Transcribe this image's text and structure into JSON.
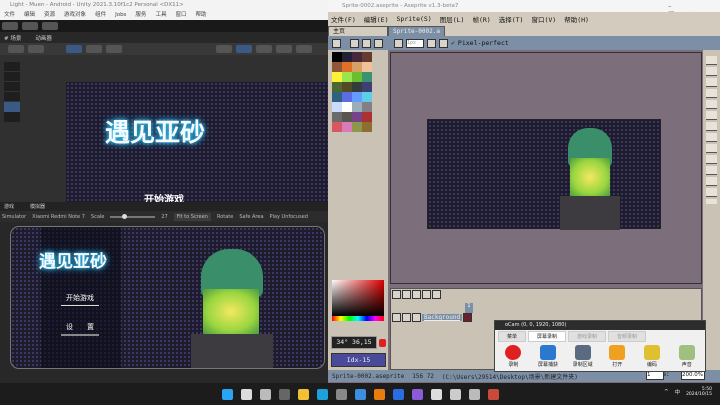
{
  "unity": {
    "title": "Light - Muen - Android - Unity 2021.3.10f1c2 Personal <DX11>",
    "menu": [
      "文件",
      "编辑",
      "资源",
      "游戏对象",
      "组件",
      "Jobs",
      "服务",
      "工具",
      "窗口",
      "帮助"
    ],
    "scene_tabs": [
      "# 场景",
      "动画器"
    ],
    "game_title": "遇见亚砂",
    "scene_start": "开始游戏",
    "game_tabs": [
      "游戏",
      "模拟器"
    ],
    "simulator": {
      "mode": "Simulator",
      "device": "Xiaomi Redmi Note 7",
      "scale_label": "Scale",
      "scale_value": "27",
      "scale_fraction": 0.25,
      "fit": "Fit to Screen",
      "rotate": "Rotate",
      "safe_area": "Safe Area",
      "play": "Play Unfocused"
    },
    "device_title": "遇见亚砂",
    "start_button": "开始游戏",
    "settings_button": "设　　置"
  },
  "aseprite": {
    "title": "Sprite-0002.aseprite - Aseprite v1.3-beta7",
    "menu": [
      "文件(F)",
      "编辑(E)",
      "Sprite(S)",
      "图层(L)",
      "帧(R)",
      "选择(T)",
      "窗口(V)",
      "帮助(H)"
    ],
    "tabs": [
      "主页",
      "Sprite-0002.a"
    ],
    "brush_size": "1px",
    "pixel_perfect": "Pixel-perfect",
    "palette": [
      "#000000",
      "#222034",
      "#45283c",
      "#663931",
      "#8f563b",
      "#df7126",
      "#d9a066",
      "#eec39a",
      "#fbf236",
      "#99e550",
      "#6abe30",
      "#37946e",
      "#4b692f",
      "#524b24",
      "#323c39",
      "#3f3f74",
      "#306082",
      "#5b6ee1",
      "#639bff",
      "#5fcde4",
      "#cbdbfc",
      "#ffffff",
      "#9badb7",
      "#847e87",
      "#696a6a",
      "#595652",
      "#76428a",
      "#ac3232",
      "#d95763",
      "#d77bba",
      "#8f974a",
      "#8a6f30"
    ],
    "color_value": "34° 36,15",
    "color_index": "Idx-15",
    "layer_name": "Background",
    "frame_number": "1",
    "status_file": "Sprite-0002.aseprite",
    "status_size": "156 72",
    "status_path": "(C:\\Users\\29514\\Desktop\\场景\\新建文件夹)",
    "frame_label": "Frame:",
    "frame_value": "1",
    "zoom": "200.0%"
  },
  "ocam": {
    "title": "oCam (0, 0, 1920, 1080)",
    "tabs": [
      "菜单",
      "屏幕录制",
      "游戏录制",
      "音频录制"
    ],
    "buttons": [
      {
        "label": "录制",
        "icon": "record-icon",
        "color": "#e02020"
      },
      {
        "label": "屏幕捕获",
        "icon": "monitor-icon",
        "color": "#2a78d0"
      },
      {
        "label": "录制区域",
        "icon": "region-icon",
        "color": "#5a6a80"
      },
      {
        "label": "打开",
        "icon": "folder-icon",
        "color": "#f0a020"
      },
      {
        "label": "编码",
        "icon": "codec-icon",
        "color": "#e0c030"
      },
      {
        "label": "声音",
        "icon": "microphone-icon",
        "color": "#a0c080"
      }
    ]
  },
  "taskbar": {
    "icons": [
      {
        "name": "start-icon",
        "color": "#2aa4f4"
      },
      {
        "name": "search-icon",
        "color": "#dddddd"
      },
      {
        "name": "task-view-icon",
        "color": "#bbbbbb"
      },
      {
        "name": "widgets-icon",
        "color": "#666666"
      },
      {
        "name": "file-explorer-icon",
        "color": "#f3c033"
      },
      {
        "name": "edge-icon",
        "color": "#1ea0d8"
      },
      {
        "name": "app-icon",
        "color": "#888888"
      },
      {
        "name": "feishu-icon",
        "color": "#3d8de0"
      },
      {
        "name": "blender-icon",
        "color": "#e87d0d"
      },
      {
        "name": "chrome-icon",
        "color": "#2a6de0"
      },
      {
        "name": "visual-studio-icon",
        "color": "#8d5ad8"
      },
      {
        "name": "aseprite-icon",
        "color": "#dddddd"
      },
      {
        "name": "unity-hub-icon",
        "color": "#cccccc"
      },
      {
        "name": "unity-icon",
        "color": "#bbbbbb"
      },
      {
        "name": "ocam-icon",
        "color": "#c84a3a"
      }
    ],
    "tray": [
      "^",
      "中"
    ],
    "time": "5:50",
    "date": "2024/10/15"
  }
}
